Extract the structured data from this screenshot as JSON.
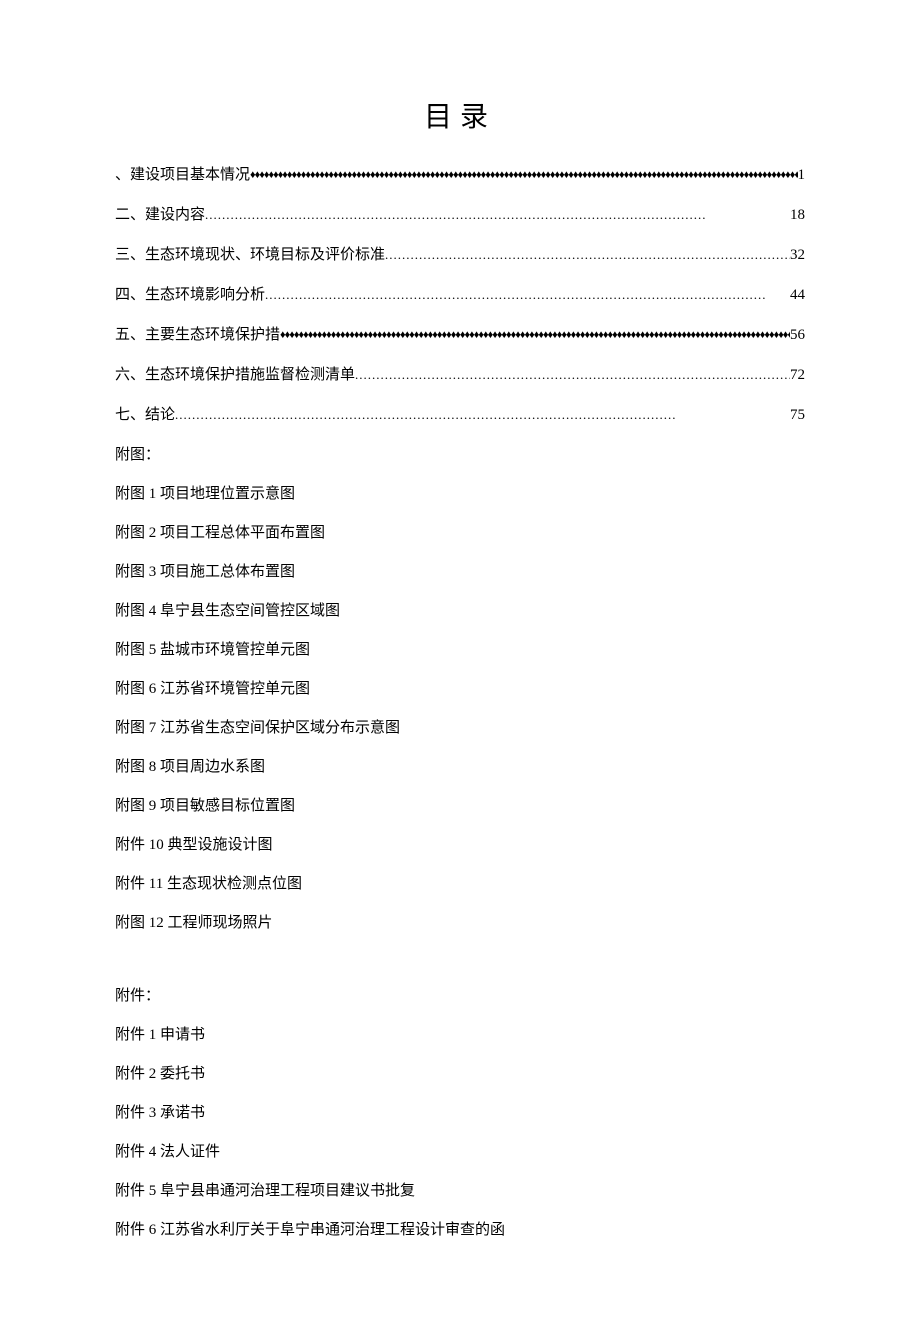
{
  "title": "目录",
  "toc": [
    {
      "label": "、建设项目基本情况",
      "leader": "diamonds",
      "page": "1"
    },
    {
      "label": "二、建设内容",
      "leader": "dots",
      "page": "18"
    },
    {
      "label": "三、生态环境现状、环境目标及评价标准",
      "leader": "dots",
      "page": "32"
    },
    {
      "label": "四、生态环境影响分析",
      "leader": "dots",
      "page": "44"
    },
    {
      "label": "五、主要生态环境保护措",
      "leader": "diamonds",
      "page": "56"
    },
    {
      "label": "六、生态环境保护措施监督检测清单",
      "leader": "dots",
      "page": "72"
    },
    {
      "label": "七、结论",
      "leader": "dots",
      "page": "75"
    }
  ],
  "figures_head": "附图：",
  "figures": [
    "附图 1 项目地理位置示意图",
    "附图 2 项目工程总体平面布置图",
    "附图 3 项目施工总体布置图",
    "附图 4 阜宁县生态空间管控区域图",
    "附图 5 盐城市环境管控单元图",
    "附图 6 江苏省环境管控单元图",
    "附图 7 江苏省生态空间保护区域分布示意图",
    "附图 8 项目周边水系图",
    "附图 9 项目敏感目标位置图",
    "附件 10 典型设施设计图",
    "附件 11 生态现状检测点位图",
    "附图 12 工程师现场照片"
  ],
  "attach_head": "附件：",
  "attachments": [
    "附件 1 申请书",
    "附件 2 委托书",
    "附件 3 承诺书",
    "附件 4 法人证件",
    "附件 5 阜宁县串通河治理工程项目建议书批复",
    "附件 6 江苏省水利厅关于阜宁串通河治理工程设计审查的函"
  ],
  "leaders": {
    "dots": "......................................................................................................................",
    "diamonds": "♦♦♦♦♦♦♦♦♦♦♦♦♦♦♦♦♦♦♦♦♦♦♦♦♦♦♦♦♦♦♦♦♦♦♦♦♦♦♦♦♦♦♦♦♦♦♦♦♦♦♦♦♦♦♦♦♦♦♦♦♦♦♦♦♦♦♦♦♦♦♦♦♦♦♦♦♦♦♦♦♦♦♦♦♦♦♦♦♦♦♦♦♦♦♦♦♦♦♦♦♦♦♦♦♦♦♦♦♦♦♦♦♦♦♦♦♦♦♦♦"
  }
}
